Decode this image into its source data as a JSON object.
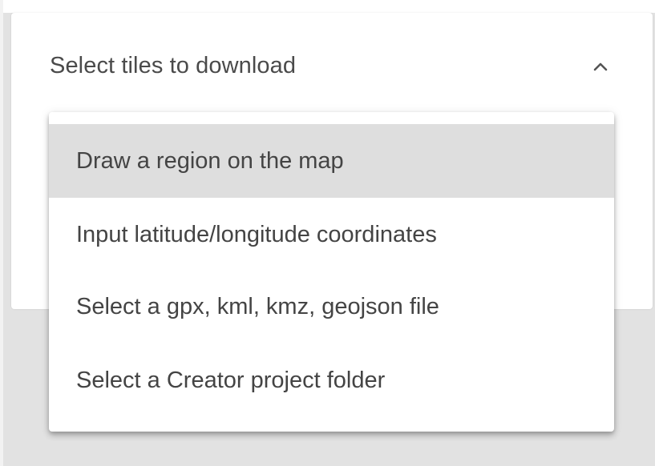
{
  "select_card": {
    "title": "Select tiles to download",
    "toggle_icon": "chevron-up-icon",
    "expanded": true
  },
  "dropdown": {
    "selected_index": 0,
    "selected_background": "#dedede",
    "options": [
      "Draw a region on the map",
      "Input latitude/longitude coordinates",
      "Select a gpx, kml, kmz, geojson file",
      "Select a Creator project folder"
    ]
  }
}
